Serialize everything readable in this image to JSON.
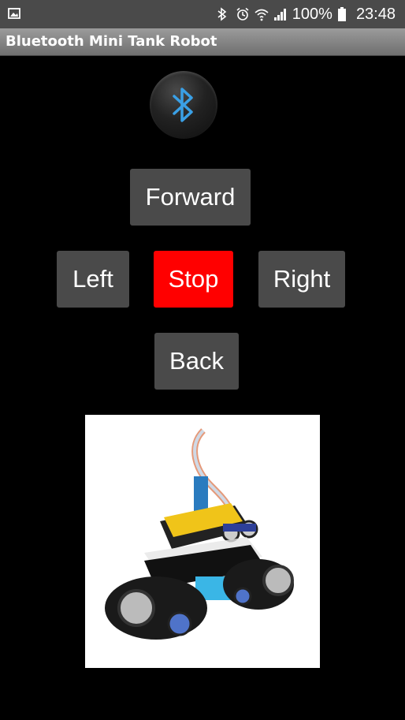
{
  "status_bar": {
    "battery": "100%",
    "time": "23:48",
    "icons": [
      "image-icon",
      "bluetooth-icon",
      "alarm-icon",
      "wifi-icon",
      "signal-icon",
      "battery-icon"
    ]
  },
  "app": {
    "title": "Bluetooth Mini Tank Robot"
  },
  "controls": {
    "bluetooth_icon": "bluetooth-icon",
    "forward": "Forward",
    "left": "Left",
    "stop": "Stop",
    "right": "Right",
    "back": "Back"
  },
  "colors": {
    "background": "#000000",
    "button": "#4a4a4a",
    "stop": "#ff0000",
    "bluetooth_accent": "#3aa0e6"
  }
}
